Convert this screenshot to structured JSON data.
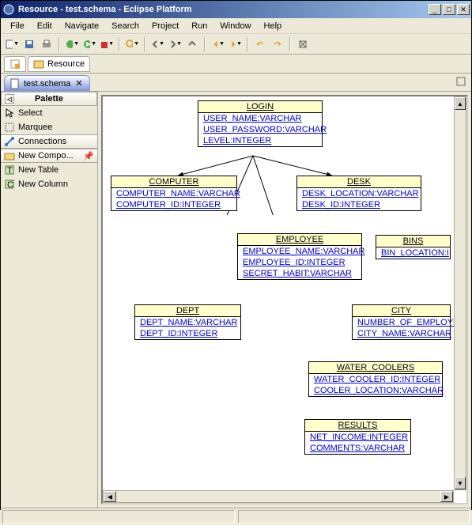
{
  "window": {
    "title": "Resource - test.schema - Eclipse Platform"
  },
  "menu": {
    "file": "File",
    "edit": "Edit",
    "navigate": "Navigate",
    "search": "Search",
    "project": "Project",
    "run": "Run",
    "window": "Window",
    "help": "Help"
  },
  "perspective": {
    "resource": "Resource"
  },
  "editor": {
    "tab": "test.schema"
  },
  "palette": {
    "title": "Palette",
    "select": "Select",
    "marquee": "Marquee",
    "connections": "Connections",
    "newcompo": "New Compo...",
    "newtable": "New Table",
    "newcolumn": "New Column"
  },
  "tables": {
    "login": {
      "name": "LOGIN",
      "c1": "USER_NAME:VARCHAR",
      "c2": "USER_PASSWORD:VARCHAR",
      "c3": "LEVEL:INTEGER"
    },
    "computer": {
      "name": "COMPUTER",
      "c1": "COMPUTER_NAME:VARCHAR",
      "c2": "COMPUTER_ID:INTEGER"
    },
    "desk": {
      "name": "DESK",
      "c1": "DESK_LOCATION:VARCHAR",
      "c2": "DESK_ID:INTEGER"
    },
    "employee": {
      "name": "EMPLOYEE",
      "c1": "EMPLOYEE_NAME:VARCHAR",
      "c2": "EMPLOYEE_ID:INTEGER",
      "c3": "SECRET_HABIT:VARCHAR"
    },
    "bins": {
      "name": "BINS",
      "c1": "BIN_LOCATION:I"
    },
    "dept": {
      "name": "DEPT",
      "c1": "DEPT_NAME:VARCHAR",
      "c2": "DEPT_ID:INTEGER"
    },
    "city": {
      "name": "CITY",
      "c1": "NUMBER_OF_EMPLOYE",
      "c2": "CITY_NAME:VARCHAR"
    },
    "watercoolers": {
      "name": "WATER_COOLERS",
      "c1": "WATER_COOLER_ID:INTEGER",
      "c2": "COOLER_LOCATION:VARCHAR"
    },
    "results": {
      "name": "RESULTS",
      "c1": "NET_INCOME:INTEGER",
      "c2": "COMMENTS:VARCHAR"
    }
  }
}
